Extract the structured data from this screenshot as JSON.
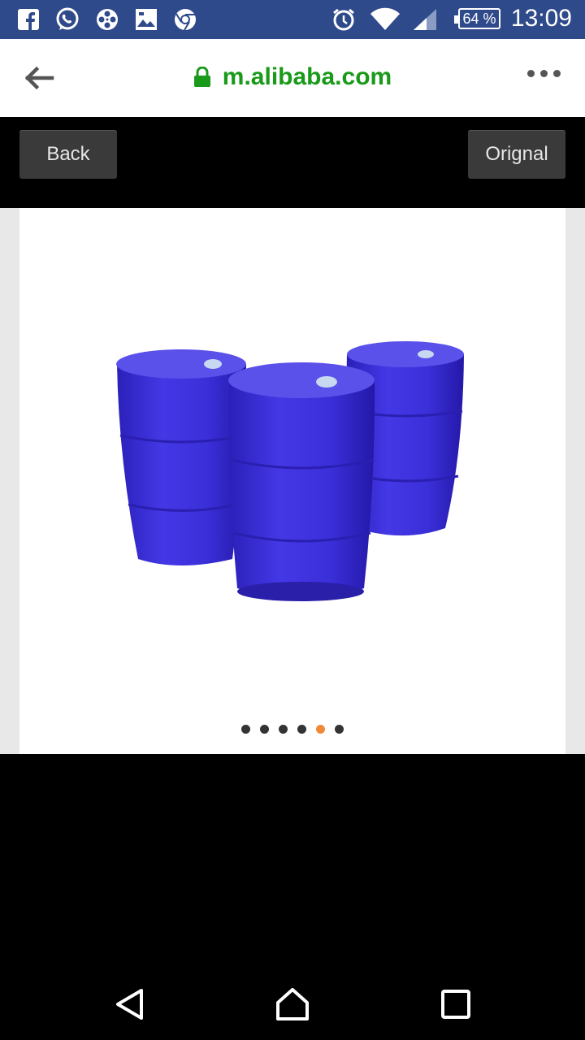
{
  "status_bar": {
    "time": "13:09",
    "battery": "64 %",
    "icons": [
      "facebook-icon",
      "whatsapp-icon",
      "film-reel-icon",
      "gallery-icon",
      "chrome-icon",
      "alarm-icon",
      "wifi-icon",
      "signal-icon",
      "battery-icon"
    ]
  },
  "browser": {
    "url": "m.alibaba.com",
    "secure": true,
    "colors": {
      "url": "#1a9a1a"
    }
  },
  "viewer": {
    "back_label": "Back",
    "original_label": "Orignal",
    "image": "blue plastic drums product photo",
    "carousel": {
      "total": 6,
      "active_index": 4,
      "active_color": "#f08a3a"
    }
  },
  "nav_bar": {
    "buttons": [
      "back-triangle-icon",
      "home-icon",
      "recents-icon"
    ]
  },
  "colors": {
    "status_bar": "#2f4a8a",
    "drum": "#3a2fd8"
  }
}
